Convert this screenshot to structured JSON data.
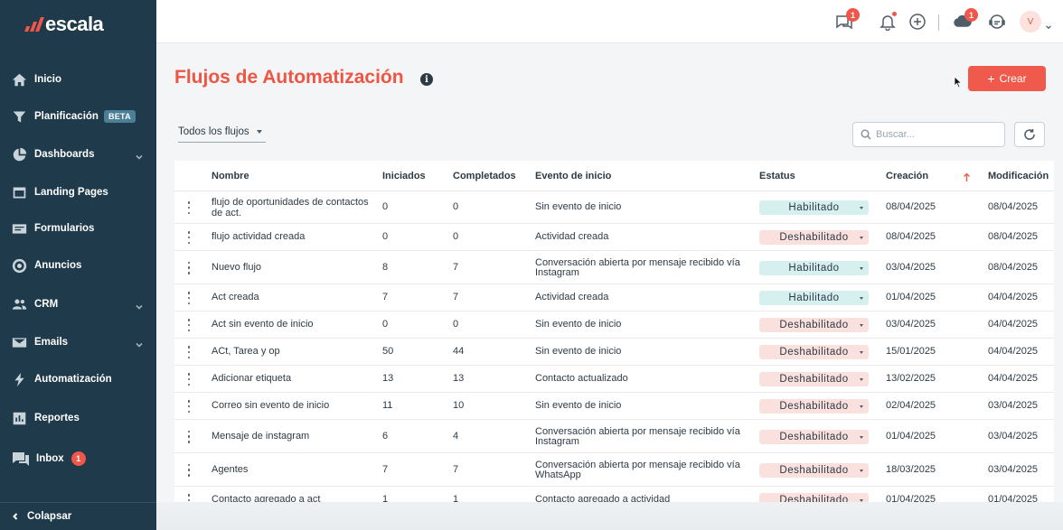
{
  "brand": {
    "name": "escala",
    "accent": "#ef5a4c",
    "sidebar_bg": "#1f3a4b"
  },
  "sidebar": {
    "items": [
      {
        "label": "Inicio",
        "icon": "home-icon"
      },
      {
        "label": "Planificación",
        "icon": "funnel-icon",
        "badge": "BETA"
      },
      {
        "label": "Dashboards",
        "icon": "pie-chart-icon",
        "expandable": true
      },
      {
        "label": "Landing Pages",
        "icon": "landing-page-icon"
      },
      {
        "label": "Formularios",
        "icon": "form-icon"
      },
      {
        "label": "Anuncios",
        "icon": "ads-icon"
      },
      {
        "label": "CRM",
        "icon": "users-icon",
        "expandable": true
      },
      {
        "label": "Emails",
        "icon": "mail-icon",
        "expandable": true
      },
      {
        "label": "Automatización",
        "icon": "bolt-icon"
      },
      {
        "label": "Reportes",
        "icon": "reports-icon"
      },
      {
        "label": "Inbox",
        "icon": "inbox-icon",
        "count": "1"
      }
    ],
    "collapse_label": "Colapsar"
  },
  "topbar": {
    "chat_badge": "1",
    "cloud_badge": "1",
    "avatar_initial": "V"
  },
  "page": {
    "title": "Flujos de Automatización",
    "create_label": "Crear",
    "filter_label": "Todos los flujos",
    "search_placeholder": "Buscar..."
  },
  "table": {
    "columns": [
      "Nombre",
      "Iniciados",
      "Completados",
      "Evento de inicio",
      "Estatus",
      "Creación",
      "Modificación"
    ],
    "sorted_column": "Creación",
    "rows": [
      {
        "name": "flujo de oportunidades de contactos de act.",
        "started": "0",
        "completed": "0",
        "event": "Sin evento de inicio",
        "status": "Habilitado",
        "enabled": true,
        "created": "08/04/2025",
        "modified": "08/04/2025"
      },
      {
        "name": "flujo actividad creada",
        "started": "0",
        "completed": "0",
        "event": "Actividad creada",
        "status": "Deshabilitado",
        "enabled": false,
        "created": "08/04/2025",
        "modified": "08/04/2025"
      },
      {
        "name": "Nuevo flujo",
        "started": "8",
        "completed": "7",
        "event": "Conversación abierta por mensaje recibido vía Instagram",
        "status": "Habilitado",
        "enabled": true,
        "created": "03/04/2025",
        "modified": "08/04/2025"
      },
      {
        "name": "Act creada",
        "started": "7",
        "completed": "7",
        "event": "Actividad creada",
        "status": "Habilitado",
        "enabled": true,
        "created": "01/04/2025",
        "modified": "04/04/2025"
      },
      {
        "name": "Act sin evento de inicio",
        "started": "0",
        "completed": "0",
        "event": "Sin evento de inicio",
        "status": "Deshabilitado",
        "enabled": false,
        "created": "03/04/2025",
        "modified": "04/04/2025"
      },
      {
        "name": "ACt, Tarea y op",
        "started": "50",
        "completed": "44",
        "event": "Sin evento de inicio",
        "status": "Deshabilitado",
        "enabled": false,
        "created": "15/01/2025",
        "modified": "04/04/2025"
      },
      {
        "name": "Adicionar etiqueta",
        "started": "13",
        "completed": "13",
        "event": "Contacto actualizado",
        "status": "Deshabilitado",
        "enabled": false,
        "created": "13/02/2025",
        "modified": "04/04/2025"
      },
      {
        "name": "Correo sin evento de inicio",
        "started": "11",
        "completed": "10",
        "event": "Sin evento de inicio",
        "status": "Deshabilitado",
        "enabled": false,
        "created": "02/04/2025",
        "modified": "03/04/2025"
      },
      {
        "name": "Mensaje de instagram",
        "started": "6",
        "completed": "4",
        "event": "Conversación abierta por mensaje recibido vía Instagram",
        "status": "Deshabilitado",
        "enabled": false,
        "created": "01/04/2025",
        "modified": "03/04/2025"
      },
      {
        "name": "Agentes",
        "started": "7",
        "completed": "7",
        "event": "Conversación abierta por mensaje recibido vía WhatsApp",
        "status": "Deshabilitado",
        "enabled": false,
        "created": "18/03/2025",
        "modified": "03/04/2025"
      },
      {
        "name": "Contacto agregado a act",
        "started": "1",
        "completed": "1",
        "event": "Contacto agregado a actividad",
        "status": "Deshabilitado",
        "enabled": false,
        "created": "01/04/2025",
        "modified": "01/04/2025"
      }
    ]
  }
}
